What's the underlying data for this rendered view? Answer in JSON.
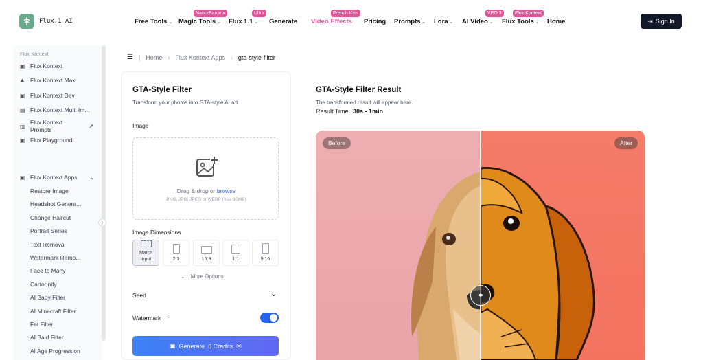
{
  "brand": {
    "name": "Flux.1 AI"
  },
  "nav": {
    "items": [
      {
        "label": "Free Tools",
        "chevron": true
      },
      {
        "label": "Magic Tools",
        "chevron": true,
        "badge": "Nano-Banana"
      },
      {
        "label": "Flux 1.1",
        "chevron": true,
        "badge": "Ultra"
      },
      {
        "label": "Generate",
        "chevron": false
      },
      {
        "label": "Video Effects",
        "chevron": false,
        "badge": "French Kiss",
        "active": true
      },
      {
        "label": "Pricing",
        "chevron": false
      },
      {
        "label": "Prompts",
        "chevron": true
      },
      {
        "label": "Lora",
        "chevron": true
      },
      {
        "label": "AI Video",
        "chevron": true,
        "badge": "VEO 3"
      },
      {
        "label": "Flux Tools",
        "chevron": true,
        "badge": "Flux Kontext"
      },
      {
        "label": "Home",
        "chevron": false
      }
    ],
    "sign_in": "Sign In"
  },
  "sidebar": {
    "heading": "Flux Kontext",
    "items": [
      {
        "label": "Flux Kontext",
        "icon": "image-icon"
      },
      {
        "label": "Flux Kontext Max",
        "icon": "mountain-icon"
      },
      {
        "label": "Flux Kontext Dev",
        "icon": "image-icon"
      },
      {
        "label": "Flux Kontext Multi Im...",
        "icon": "images-icon"
      },
      {
        "label": "Flux Kontext\nPrompts",
        "icon": "book-icon",
        "external": true
      },
      {
        "label": "Flux Playground",
        "icon": "image-icon"
      }
    ],
    "apps_group": {
      "label": "Flux Kontext Apps",
      "icon": "image-icon",
      "expanded": true
    },
    "apps": [
      "Restore Image",
      "Headshot Genera...",
      "Change Haircut",
      "Portrait Series",
      "Text Removal",
      "Watermark Remo...",
      "Face to Many",
      "Cartoonify",
      "AI Baby Filter",
      "AI Minecraft Filter",
      "Fat Filter",
      "AI Bald Filter",
      "AI Age Progression"
    ]
  },
  "breadcrumb": {
    "home": "Home",
    "section": "Flux Kontext Apps",
    "current": "gta-style-filter"
  },
  "form": {
    "title": "GTA-Style Filter",
    "subtitle": "Transform your photos into GTA-style AI art",
    "image_label": "Image",
    "drop_text": "Drag & drop or ",
    "drop_link": "browse",
    "drop_hint": "PNG, JPG, JPEG or WEBP (max 10MB)",
    "dimensions_label": "Image Dimensions",
    "dimensions": [
      {
        "label": "Match\nInput",
        "selected": true
      },
      {
        "label": "2:3",
        "selected": false
      },
      {
        "label": "16:9",
        "selected": false
      },
      {
        "label": "1:1",
        "selected": false
      },
      {
        "label": "9:16",
        "selected": false
      }
    ],
    "more_options": "More Options",
    "seed_label": "Seed",
    "watermark_label": "Watermark",
    "watermark_on": true,
    "generate_label": "Generate",
    "generate_credits": "6 Credits"
  },
  "result": {
    "title": "GTA-Style Filter Result",
    "subtitle": "The transformed result will appear here.",
    "time_label": "Result Time",
    "time_value": "30s - 1min",
    "before_tag": "Before",
    "after_tag": "After"
  },
  "colors": {
    "accent": "#2563eb",
    "nav_active": "#ee5ea8",
    "badge": "#e0569a",
    "before_bg": "#eeaeb2",
    "after_bg": "#f47c69"
  }
}
